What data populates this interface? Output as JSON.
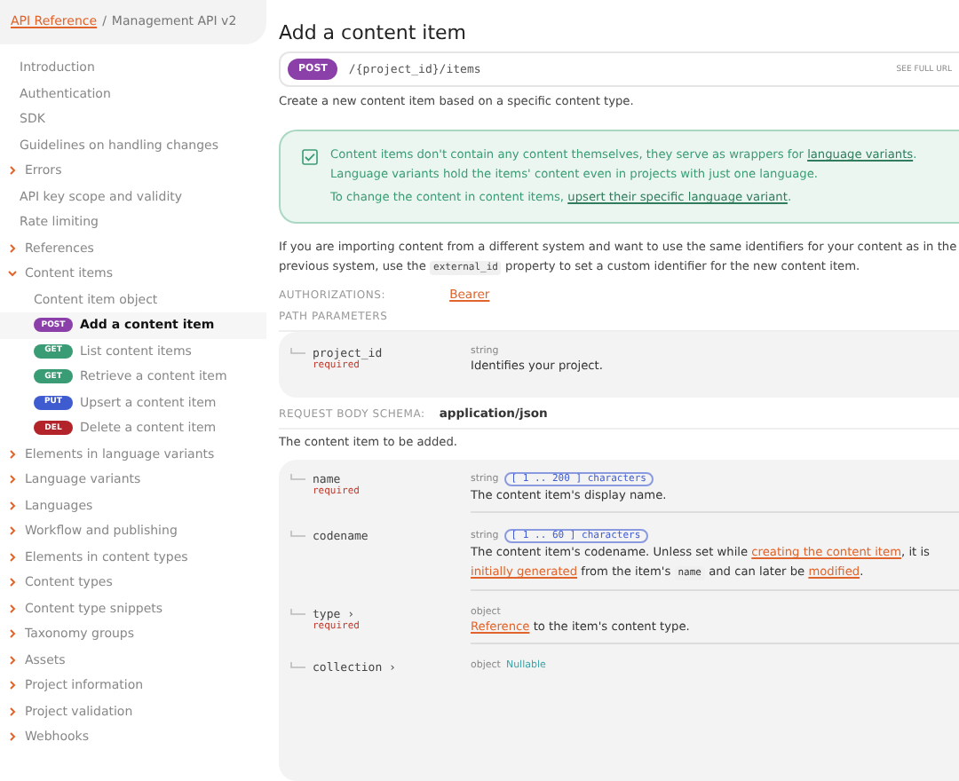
{
  "breadcrumb": {
    "link": "API Reference",
    "separator": "/",
    "current": "Management API v2"
  },
  "nav": [
    {
      "label": "Introduction",
      "kind": "page",
      "selected": false
    },
    {
      "label": "Authentication",
      "kind": "page",
      "selected": false
    },
    {
      "label": "SDK",
      "kind": "page",
      "selected": false
    },
    {
      "label": "Guidelines on handling changes",
      "kind": "page",
      "selected": false
    },
    {
      "label": "Errors",
      "kind": "section",
      "expanded": false,
      "selected": false
    },
    {
      "label": "API key scope and validity",
      "kind": "page",
      "selected": false
    },
    {
      "label": "Rate limiting",
      "kind": "page",
      "selected": false
    },
    {
      "label": "References",
      "kind": "section",
      "expanded": false,
      "selected": false
    },
    {
      "label": "Content items",
      "kind": "section",
      "expanded": true,
      "selected": false,
      "children": [
        {
          "label": "Content item object",
          "kind": "page",
          "selected": false
        },
        {
          "label": "Add a content item",
          "kind": "endpoint",
          "method": "POST",
          "color": "#8b3fa8",
          "selected": true
        },
        {
          "label": "List content items",
          "kind": "endpoint",
          "method": "GET",
          "color": "#3a9c74",
          "selected": false
        },
        {
          "label": "Retrieve a content item",
          "kind": "endpoint",
          "method": "GET",
          "color": "#3a9c74",
          "selected": false
        },
        {
          "label": "Upsert a content item",
          "kind": "endpoint",
          "method": "PUT",
          "color": "#3f5bd0",
          "selected": false
        },
        {
          "label": "Delete a content item",
          "kind": "endpoint",
          "method": "DEL",
          "color": "#b3232a",
          "selected": false
        }
      ]
    },
    {
      "label": "Elements in language variants",
      "kind": "section",
      "expanded": false,
      "selected": false
    },
    {
      "label": "Language variants",
      "kind": "section",
      "expanded": false,
      "selected": false
    },
    {
      "label": "Languages",
      "kind": "section",
      "expanded": false,
      "selected": false
    },
    {
      "label": "Workflow and publishing",
      "kind": "section",
      "expanded": false,
      "selected": false
    },
    {
      "label": "Elements in content types",
      "kind": "section",
      "expanded": false,
      "selected": false
    },
    {
      "label": "Content types",
      "kind": "section",
      "expanded": false,
      "selected": false
    },
    {
      "label": "Content type snippets",
      "kind": "section",
      "expanded": false,
      "selected": false
    },
    {
      "label": "Taxonomy groups",
      "kind": "section",
      "expanded": false,
      "selected": false
    },
    {
      "label": "Assets",
      "kind": "section",
      "expanded": false,
      "selected": false
    },
    {
      "label": "Project information",
      "kind": "section",
      "expanded": false,
      "selected": false
    },
    {
      "label": "Project validation",
      "kind": "section",
      "expanded": false,
      "selected": false
    },
    {
      "label": "Webhooks",
      "kind": "section",
      "expanded": false,
      "selected": false
    }
  ],
  "title": "Add a content item",
  "endpoint": {
    "method": "POST",
    "path": "/{project_id}/items",
    "full_url_label": "SEE FULL URL"
  },
  "summary": "Create a new content item based on a specific content type.",
  "callout": {
    "checked": true,
    "paragraphs": [
      [
        {
          "kind": "text",
          "text": "Content items don't contain any content themselves, they serve as wrappers for "
        },
        {
          "kind": "link",
          "text": "language variants"
        },
        {
          "kind": "text",
          "text": ". Language variants hold the items' content even in projects with just one language."
        }
      ],
      [
        {
          "kind": "text",
          "text": "To change the content in content items, "
        },
        {
          "kind": "link",
          "text": "upsert their specific language variant"
        },
        {
          "kind": "text",
          "text": "."
        }
      ]
    ]
  },
  "intro": [
    {
      "kind": "text",
      "text": "If you are importing content from a different system and want to use the same identifiers for your content as in the previous system, use the "
    },
    {
      "kind": "code",
      "text": "external_id"
    },
    {
      "kind": "text",
      "text": " property to set a custom identifier for the new content item."
    }
  ],
  "authorizations": {
    "label": "AUTHORIZATIONS:",
    "value": "Bearer"
  },
  "path_parameters": {
    "heading": "PATH PARAMETERS",
    "params": [
      {
        "name": "project_id",
        "required": "required",
        "type": "string",
        "description": [
          {
            "kind": "text",
            "text": "Identifies your project."
          }
        ]
      }
    ]
  },
  "request_body": {
    "label": "REQUEST BODY SCHEMA:",
    "value": "application/json",
    "description": "The content item to be added.",
    "params": [
      {
        "name": "name",
        "required": "required",
        "type": "string",
        "constraint": "[ 1 .. 200 ] characters",
        "description": [
          {
            "kind": "text",
            "text": "The content item's display name."
          }
        ]
      },
      {
        "name": "codename",
        "type": "string",
        "constraint": "[ 1 .. 60 ] characters",
        "description": [
          {
            "kind": "text",
            "text": "The content item's codename. Unless set while "
          },
          {
            "kind": "link",
            "text": "creating the content item"
          },
          {
            "kind": "text",
            "text": ", it is "
          },
          {
            "kind": "link",
            "text": "initially generated"
          },
          {
            "kind": "text",
            "text": " from the item's "
          },
          {
            "kind": "code",
            "text": "name"
          },
          {
            "kind": "text",
            "text": " and can later be "
          },
          {
            "kind": "link",
            "text": "modified"
          },
          {
            "kind": "text",
            "text": "."
          }
        ]
      },
      {
        "name": "type",
        "expand": "›",
        "required": "required",
        "type": "object",
        "description": [
          {
            "kind": "link",
            "text": "Reference"
          },
          {
            "kind": "text",
            "text": " to the item's content type."
          }
        ]
      },
      {
        "name": "collection",
        "expand": "›",
        "type": "object",
        "nullable": "Nullable"
      }
    ]
  }
}
